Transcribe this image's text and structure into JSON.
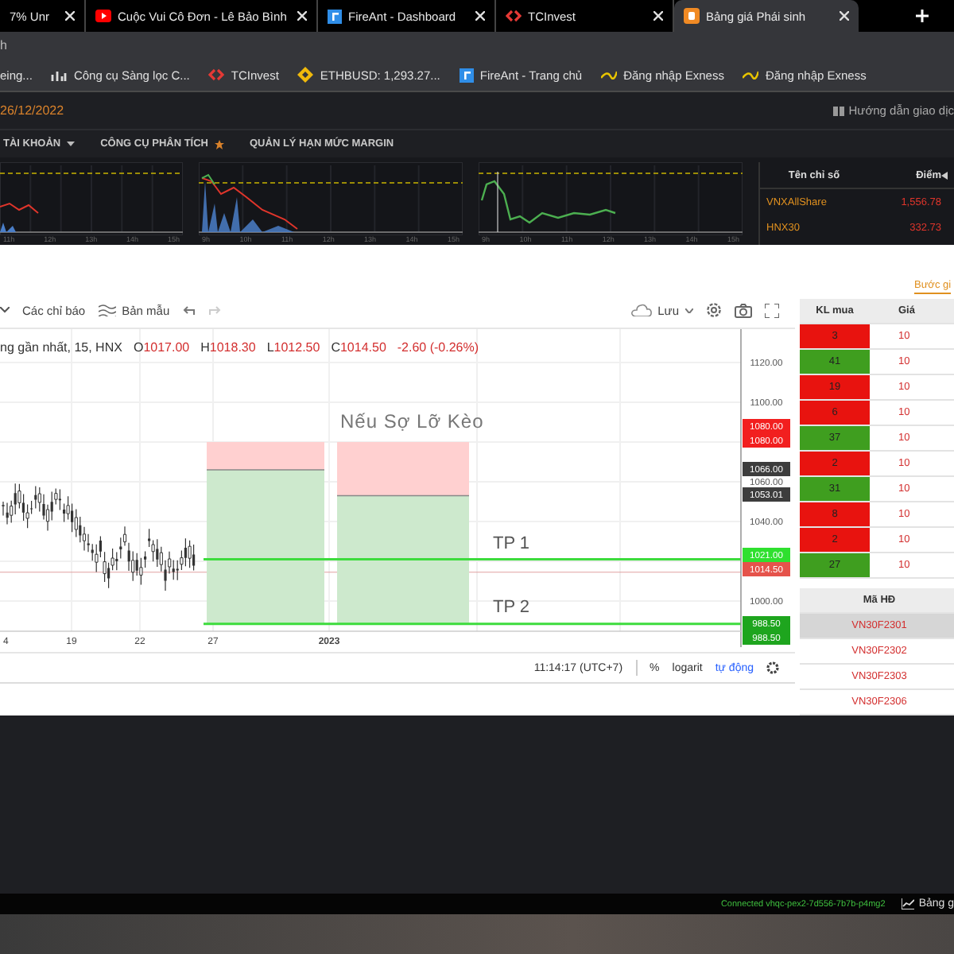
{
  "browser": {
    "tabs": [
      {
        "title": "7% Unr",
        "kind": "none",
        "selected": false
      },
      {
        "title": "Cuộc Vui Cô Đơn - Lê Bảo Bình",
        "kind": "video",
        "selected": false
      },
      {
        "title": "FireAnt - Dashboard",
        "kind": "square",
        "selected": false
      },
      {
        "title": "TCInvest",
        "kind": "code",
        "selected": false
      },
      {
        "title": "Bảng giá Phái sinh",
        "kind": "orange",
        "selected": true
      }
    ],
    "address": "h",
    "bookmarks": [
      {
        "title": "eing...",
        "kind": "none"
      },
      {
        "title": "Công cụ Sàng lọc C...",
        "kind": "chart"
      },
      {
        "title": "TCInvest",
        "kind": "code"
      },
      {
        "title": "ETHBUSD: 1,293.27...",
        "kind": "diamond"
      },
      {
        "title": "FireAnt - Trang chủ",
        "kind": "square"
      },
      {
        "title": "Đăng nhập Exness",
        "kind": "swoosh"
      },
      {
        "title": "Đăng nhập Exness",
        "kind": "swoosh"
      }
    ]
  },
  "header": {
    "date": "26/12/2022",
    "guide": "Hướng dẫn giao dịc"
  },
  "menu": [
    {
      "label": "TÀI KHOẢN",
      "kind": "dropdown"
    },
    {
      "label": "CÔNG CỤ PHÂN TÍCH",
      "kind": "star"
    },
    {
      "label": "QUẢN LÝ HẠN MỨC MARGIN",
      "kind": "plain"
    }
  ],
  "mini_charts": [
    {
      "ticks": [
        "11h",
        "12h",
        "13h",
        "14h",
        "15h"
      ]
    },
    {
      "ticks": [
        "9h",
        "10h",
        "11h",
        "12h",
        "13h",
        "14h",
        "15h"
      ]
    },
    {
      "ticks": [
        "9h",
        "10h",
        "11h",
        "12h",
        "13h",
        "14h",
        "15h"
      ]
    }
  ],
  "index_table": {
    "columns": [
      "Tên chỉ số",
      "Điểm"
    ],
    "rows": [
      {
        "name": "VNXAllShare",
        "value": "1,556.78"
      },
      {
        "name": "HNX30",
        "value": "332.73"
      }
    ]
  },
  "toolbar": {
    "indicators": "Các chỉ báo",
    "templates": "Bản mẫu",
    "save": "Lưu"
  },
  "legend": {
    "symbol": "ng gần nhất, 15, HNX",
    "values": [
      {
        "label": "O",
        "value": "1017.00"
      },
      {
        "label": "H",
        "value": "1018.30"
      },
      {
        "label": "L",
        "value": "1012.50"
      },
      {
        "label": "C",
        "value": "1014.50"
      }
    ],
    "change": "-2.60 (-0.26%)"
  },
  "annotations": {
    "title": "Nếu Sợ Lỡ Kèo",
    "targets": [
      "TP 1",
      "TP 2"
    ]
  },
  "price_axis": [
    {
      "label": "1120.00",
      "kind": "plain"
    },
    {
      "label": "1100.00",
      "kind": "plain"
    },
    {
      "label": "1080.00",
      "kind": "sell"
    },
    {
      "label": "1080.00",
      "kind": "sell"
    },
    {
      "label": "1066.00",
      "kind": "neutral"
    },
    {
      "label": "1060.00",
      "kind": "plain"
    },
    {
      "label": "1053.01",
      "kind": "neutral"
    },
    {
      "label": "1040.00",
      "kind": "plain"
    },
    {
      "label": "1021.00",
      "kind": "target"
    },
    {
      "label": "1014.50",
      "kind": "last"
    },
    {
      "label": "1000.00",
      "kind": "plain"
    },
    {
      "label": "988.50",
      "kind": "buy"
    },
    {
      "label": "988.50",
      "kind": "buy"
    }
  ],
  "time_axis": [
    "4",
    "19",
    "22",
    "27",
    "2023"
  ],
  "bottom_bar": {
    "time": "11:14:17 (UTC+7)",
    "modes": [
      {
        "label": "%",
        "selected": false
      },
      {
        "label": "logarit",
        "selected": false
      },
      {
        "label": "tự động",
        "selected": true
      }
    ]
  },
  "order_book": {
    "tab": "Bước gi",
    "columns": [
      "KL mua",
      "Giá"
    ],
    "rows": [
      {
        "volume": "3",
        "price": "10",
        "color": "#e8130f"
      },
      {
        "volume": "41",
        "price": "10",
        "color": "#3f9e1f"
      },
      {
        "volume": "19",
        "price": "10",
        "color": "#e8130f"
      },
      {
        "volume": "6",
        "price": "10",
        "color": "#e8130f"
      },
      {
        "volume": "37",
        "price": "10",
        "color": "#3f9e1f"
      },
      {
        "volume": "2",
        "price": "10",
        "color": "#e8130f"
      },
      {
        "volume": "31",
        "price": "10",
        "color": "#3f9e1f"
      },
      {
        "volume": "8",
        "price": "10",
        "color": "#e8130f"
      },
      {
        "volume": "2",
        "price": "10",
        "color": "#e8130f"
      },
      {
        "volume": "27",
        "price": "10",
        "color": "#3f9e1f"
      }
    ]
  },
  "contracts": {
    "column": "Mã HĐ",
    "rows": [
      {
        "code": "VN30F2301",
        "selected": true
      },
      {
        "code": "VN30F2302",
        "selected": false
      },
      {
        "code": "VN30F2303",
        "selected": false
      },
      {
        "code": "VN30F2306",
        "selected": false
      }
    ]
  },
  "status": {
    "connection": "Connected vhqc-pex2-7d556-7b7b-p4mg2",
    "board": "Bảng g"
  }
}
